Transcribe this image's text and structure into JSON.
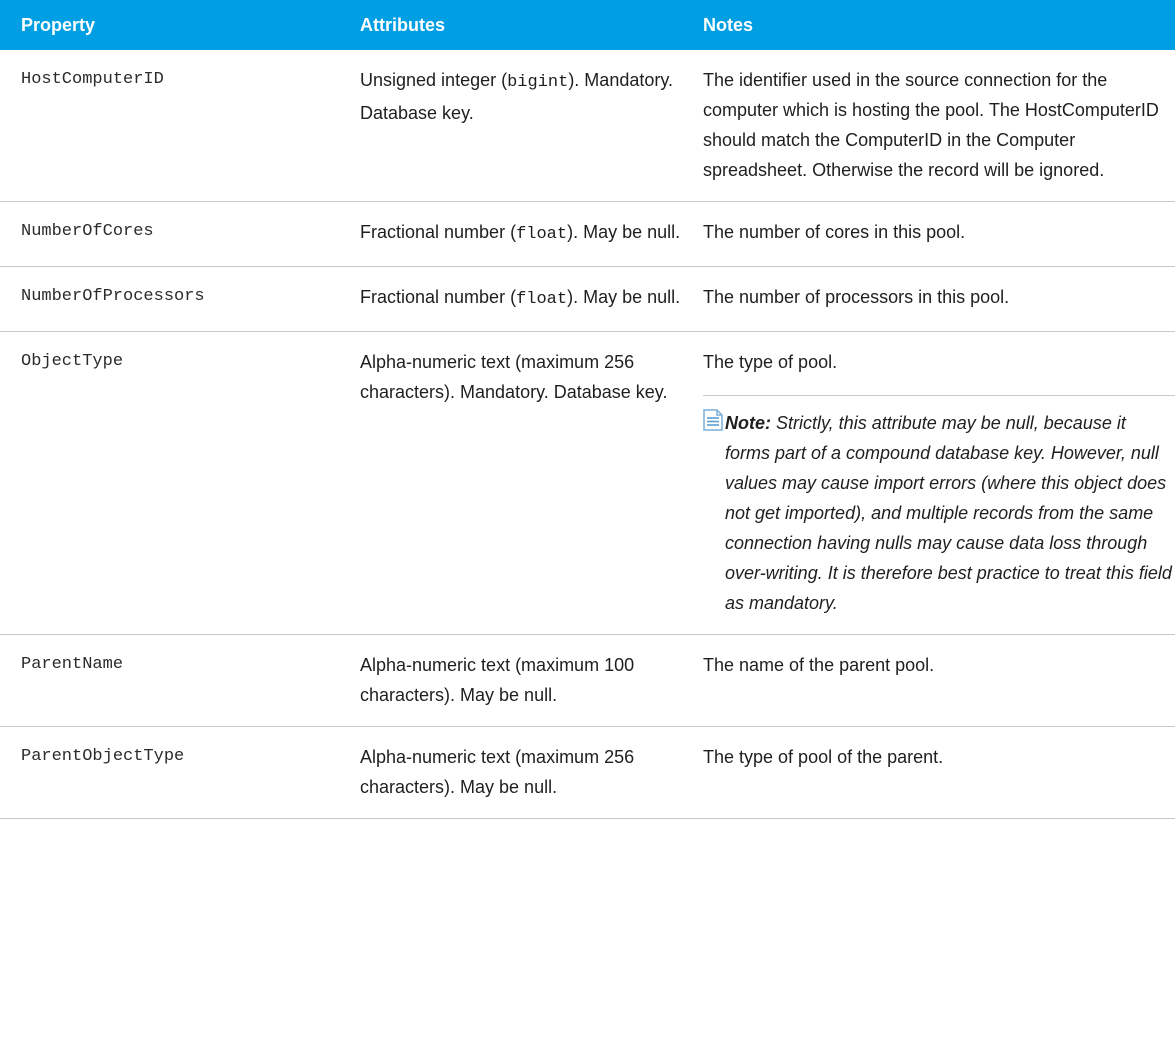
{
  "table": {
    "headers": {
      "property": "Property",
      "attributes": "Attributes",
      "notes": "Notes"
    },
    "rows": [
      {
        "property": "HostComputerID",
        "attributes_pre": "Unsigned integer (",
        "attributes_code": "bigint",
        "attributes_post": "). Mandatory. Database key.",
        "notes": "The identifier used in the source connection for the computer which is hosting the pool. The HostComputerID should match the ComputerID in the Computer spreadsheet. Otherwise the record will be ignored."
      },
      {
        "property": "NumberOfCores",
        "attributes_pre": "Fractional number (",
        "attributes_code": "float",
        "attributes_post": "). May be null.",
        "notes": "The number of cores in this pool."
      },
      {
        "property": "NumberOfProcessors",
        "attributes_pre": "Fractional number (",
        "attributes_code": "float",
        "attributes_post": "). May be null.",
        "notes": "The number of processors in this pool."
      },
      {
        "property": "ObjectType",
        "attributes": "Alpha-numeric text (maximum 256 characters). Mandatory. Database key.",
        "notes": "The type of pool.",
        "note_label": "Note:",
        "note_text": "Strictly, this attribute may be null, because it forms part of a compound database key. However, null values may cause import errors (where this object does not get imported), and multiple records from the same connection having nulls may cause data loss through over-writing. It is therefore best practice to treat this field as mandatory."
      },
      {
        "property": "ParentName",
        "attributes": "Alpha-numeric text (maximum 100 characters). May be null.",
        "notes": "The name of the parent pool."
      },
      {
        "property": "ParentObjectType",
        "attributes": "Alpha-numeric text (maximum 256 characters). May be null.",
        "notes": "The type of pool of the parent."
      }
    ]
  },
  "colors": {
    "header_bg": "#009ee3",
    "header_text": "#ffffff",
    "row_border": "#c8c8c8"
  },
  "icons": {
    "note": "note-document-icon"
  }
}
